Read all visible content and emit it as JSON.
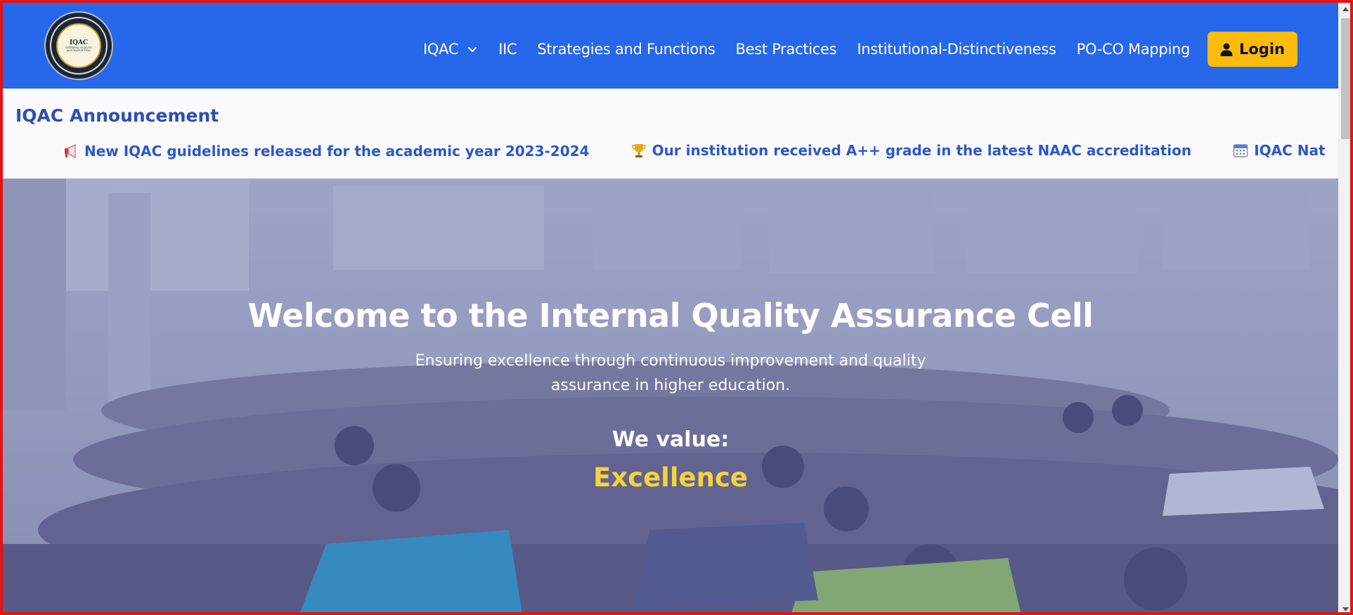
{
  "header": {
    "logo": {
      "alt": "Institute logo",
      "title": "IQAC",
      "subtitle": "INTERNAL QUALITY ASSURANCE CELL"
    },
    "nav_items": [
      {
        "label": "IQAC",
        "has_dropdown": true
      },
      {
        "label": "IIC"
      },
      {
        "label": "Strategies and Functions"
      },
      {
        "label": "Best Practices"
      },
      {
        "label": "Institutional-Distinctiveness"
      },
      {
        "label": "PO-CO Mapping"
      }
    ],
    "login_label": "Login"
  },
  "announcement": {
    "title": "IQAC Announcement",
    "items": [
      {
        "icon": "megaphone-icon",
        "text": "New IQAC guidelines released for the academic year 2023-2024"
      },
      {
        "icon": "trophy-icon",
        "text": "Our institution received A++ grade in the latest NAAC accreditation"
      },
      {
        "icon": "calendar-icon",
        "text": "IQAC National Conference o"
      }
    ]
  },
  "hero": {
    "heading": "Welcome to the Internal Quality Assurance Cell",
    "subtitle": "Ensuring excellence through continuous improvement and quality assurance in higher education.",
    "value_label": "We value:",
    "value_word": "Excellence"
  },
  "colors": {
    "nav_bg": "#2767ea",
    "login_bg": "#fdbb0c",
    "announce_text": "#2e57c7",
    "highlight": "#f5d33c",
    "window_border": "#e01515"
  }
}
